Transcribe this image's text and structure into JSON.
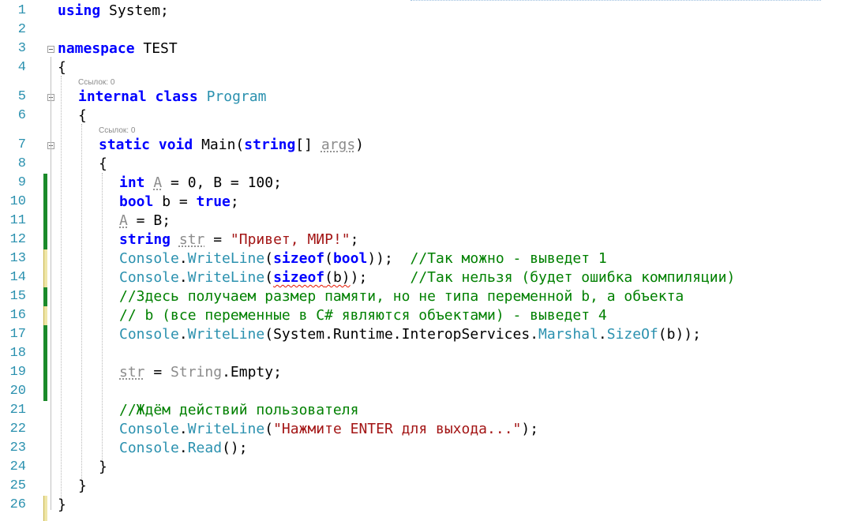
{
  "editor": {
    "codelens": [
      "Ссылок: 0",
      "Ссылок: 0"
    ],
    "lines": [
      {
        "n": "1",
        "indent": 0,
        "tokens": [
          [
            "kw",
            "using"
          ],
          [
            "p",
            " System;"
          ]
        ]
      },
      {
        "n": "2",
        "indent": 0,
        "tokens": []
      },
      {
        "n": "3",
        "indent": 0,
        "tokens": [
          [
            "kw",
            "namespace"
          ],
          [
            "p",
            " TEST"
          ]
        ]
      },
      {
        "n": "4",
        "indent": 0,
        "tokens": [
          [
            "p",
            "{"
          ]
        ]
      },
      {
        "n": "5",
        "indent": 1,
        "tokens": [
          [
            "kw",
            "internal"
          ],
          [
            "p",
            " "
          ],
          [
            "kw",
            "class"
          ],
          [
            "p",
            " "
          ],
          [
            "ty",
            "Program"
          ]
        ]
      },
      {
        "n": "6",
        "indent": 1,
        "tokens": [
          [
            "p",
            "{"
          ]
        ]
      },
      {
        "n": "7",
        "indent": 2,
        "tokens": [
          [
            "kw",
            "static"
          ],
          [
            "p",
            " "
          ],
          [
            "kw",
            "void"
          ],
          [
            "p",
            " Main("
          ],
          [
            "kw",
            "string"
          ],
          [
            "p",
            "[] "
          ],
          [
            "unused_d",
            "args"
          ],
          [
            "p",
            ")"
          ]
        ]
      },
      {
        "n": "8",
        "indent": 2,
        "tokens": [
          [
            "p",
            "{"
          ]
        ]
      },
      {
        "n": "9",
        "indent": 3,
        "tokens": [
          [
            "kw",
            "int"
          ],
          [
            "p",
            " "
          ],
          [
            "unused_d",
            "A"
          ],
          [
            "p",
            " = 0, B = 100;"
          ]
        ]
      },
      {
        "n": "10",
        "indent": 3,
        "tokens": [
          [
            "kw",
            "bool"
          ],
          [
            "p",
            " b = "
          ],
          [
            "kw",
            "true"
          ],
          [
            "p",
            ";"
          ]
        ]
      },
      {
        "n": "11",
        "indent": 3,
        "tokens": [
          [
            "unused_d",
            "A"
          ],
          [
            "p",
            " = B;"
          ]
        ]
      },
      {
        "n": "12",
        "indent": 3,
        "tokens": [
          [
            "kw",
            "string"
          ],
          [
            "p",
            " "
          ],
          [
            "unused_d",
            "str"
          ],
          [
            "p",
            " = "
          ],
          [
            "str",
            "\"Привет, МИР!\""
          ],
          [
            "p",
            ";"
          ]
        ]
      },
      {
        "n": "13",
        "indent": 3,
        "tokens": [
          [
            "ty",
            "Console"
          ],
          [
            "p",
            "."
          ],
          [
            "ty",
            "WriteLine"
          ],
          [
            "p",
            "("
          ],
          [
            "kw",
            "sizeof"
          ],
          [
            "p",
            "("
          ],
          [
            "kw",
            "bool"
          ],
          [
            "p",
            "));  "
          ],
          [
            "cm",
            "//Так можно - выведет 1"
          ]
        ]
      },
      {
        "n": "14",
        "indent": 3,
        "tokens": [
          [
            "ty",
            "Console"
          ],
          [
            "p",
            "."
          ],
          [
            "ty",
            "WriteLine"
          ],
          [
            "p",
            "("
          ],
          [
            "kw_sq",
            "sizeof"
          ],
          [
            "sq",
            "(b)"
          ],
          [
            "p",
            ");     "
          ],
          [
            "cm",
            "//Так нельзя (будет ошибка компиляции)"
          ]
        ]
      },
      {
        "n": "15",
        "indent": 3,
        "tokens": [
          [
            "cm",
            "//Здесь получаем размер памяти, но не типа переменной b, а объекта"
          ]
        ]
      },
      {
        "n": "16",
        "indent": 3,
        "tokens": [
          [
            "cm",
            "// b (все переменные в C# являются объектами) - выведет 4"
          ]
        ]
      },
      {
        "n": "17",
        "indent": 3,
        "tokens": [
          [
            "ty",
            "Console"
          ],
          [
            "p",
            "."
          ],
          [
            "ty",
            "WriteLine"
          ],
          [
            "p",
            "(System.Runtime.InteropServices."
          ],
          [
            "ty",
            "Marshal"
          ],
          [
            "p",
            "."
          ],
          [
            "ty",
            "SizeOf"
          ],
          [
            "p",
            "(b));"
          ]
        ]
      },
      {
        "n": "18",
        "indent": 3,
        "tokens": []
      },
      {
        "n": "19",
        "indent": 3,
        "tokens": [
          [
            "unused_d",
            "str"
          ],
          [
            "p",
            " = "
          ],
          [
            "unused",
            "String"
          ],
          [
            "p",
            ".Empty;"
          ]
        ]
      },
      {
        "n": "20",
        "indent": 3,
        "tokens": []
      },
      {
        "n": "21",
        "indent": 3,
        "tokens": [
          [
            "cm",
            "//Ждём действий пользователя"
          ]
        ]
      },
      {
        "n": "22",
        "indent": 3,
        "tokens": [
          [
            "ty",
            "Console"
          ],
          [
            "p",
            "."
          ],
          [
            "ty",
            "WriteLine"
          ],
          [
            "p",
            "("
          ],
          [
            "str",
            "\"Нажмите ENTER для выхода...\""
          ],
          [
            "p",
            ");"
          ]
        ]
      },
      {
        "n": "23",
        "indent": 3,
        "tokens": [
          [
            "ty",
            "Console"
          ],
          [
            "p",
            "."
          ],
          [
            "ty",
            "Read"
          ],
          [
            "p",
            "();"
          ]
        ]
      },
      {
        "n": "24",
        "indent": 2,
        "tokens": [
          [
            "p",
            "}"
          ]
        ]
      },
      {
        "n": "25",
        "indent": 1,
        "tokens": [
          [
            "p",
            "}"
          ]
        ]
      },
      {
        "n": "26",
        "indent": 0,
        "tokens": [
          [
            "p",
            "}"
          ]
        ]
      }
    ]
  }
}
